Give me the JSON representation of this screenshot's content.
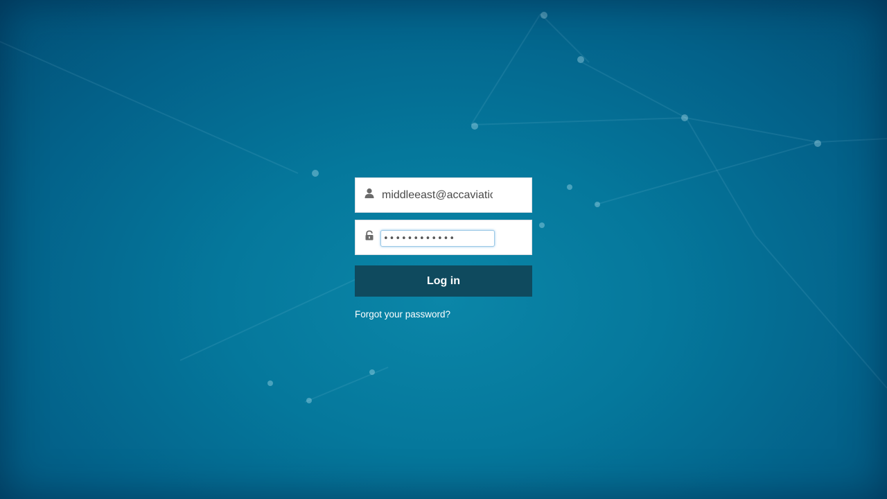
{
  "login": {
    "username_value": "middleeast@accaviatic",
    "password_value": "••••••••••••",
    "button_label": "Log in",
    "forgot_link": "Forgot your password?"
  },
  "icons": {
    "username": "user-icon",
    "password": "lock-icon"
  },
  "colors": {
    "background": "#05789c",
    "button": "#0f4a5e",
    "link": "#ffffff",
    "icon": "#6b6b6b"
  }
}
